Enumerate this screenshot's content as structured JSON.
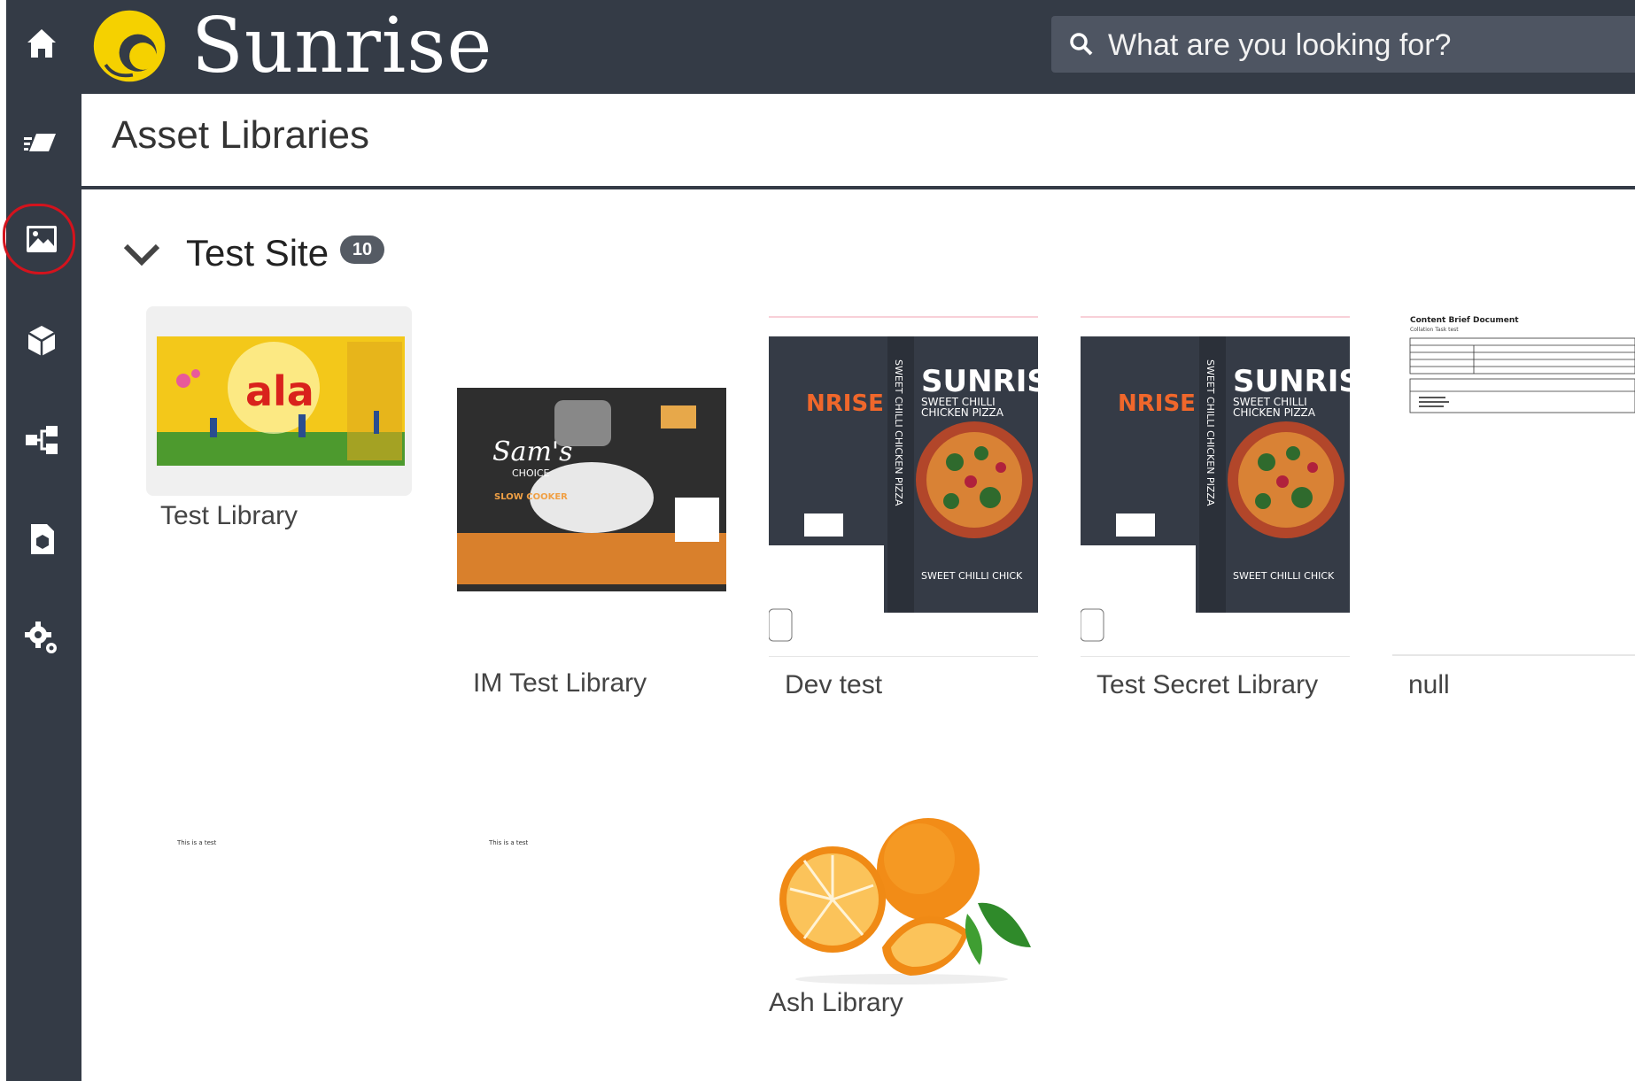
{
  "app": {
    "brand": "Sunrise"
  },
  "search": {
    "placeholder": "What are you looking for?"
  },
  "page": {
    "title": "Asset Libraries"
  },
  "group": {
    "name": "Test Site",
    "count": "10"
  },
  "libraries": [
    {
      "label": "Test Library"
    },
    {
      "label": "IM Test Library"
    },
    {
      "label": "Dev test"
    },
    {
      "label": "Test Secret Library"
    },
    {
      "label": "null"
    },
    {
      "label": ""
    },
    {
      "label": ""
    },
    {
      "label": "Ash Library"
    }
  ],
  "thumbs": {
    "pizza_brand": "SUNRISE",
    "pizza_brand_cut": "NRISE",
    "pizza_sub1": "SWEET CHILLI",
    "pizza_sub2": "CHICKEN PIZZA",
    "pizza_spine": "SWEET CHILLI CHICKEN PIZZA",
    "pizza_footer": "SWEET CHILLI CHICK",
    "doc_title": "Content Brief Document",
    "doc_sub": "Collation Task test",
    "text_test": "This is a test",
    "ala_brand": "ala",
    "sams_brand": "Sam's",
    "sams_choice": "CHOICE",
    "sams_product": "SLOW COOKER"
  },
  "colors": {
    "chrome": "#343b46",
    "accent_yellow": "#f5d100",
    "ring": "#d3131d"
  },
  "icons": [
    "home-icon",
    "eraser-icon",
    "image-icon",
    "cube-icon",
    "workflow-icon",
    "document-cube-icon",
    "gears-icon",
    "search-icon",
    "chevron-down-icon"
  ]
}
